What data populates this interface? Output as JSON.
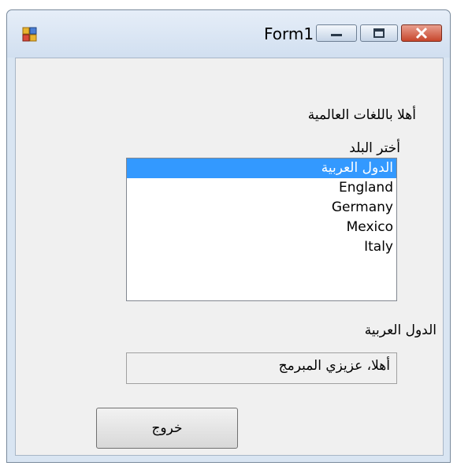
{
  "window": {
    "title": "Form1"
  },
  "form": {
    "welcome_label": "أهلا باللغات العالمية",
    "choose_country_label": "أختر البلد",
    "countries": [
      "الدول العربية",
      "England",
      "Germany",
      "Mexico",
      "Italy"
    ],
    "selected_index": 0,
    "selected_country_label": "الدول العربية",
    "greeting_text": "أهلا، عزيزي المبرمج",
    "exit_button_label": "خروج"
  }
}
